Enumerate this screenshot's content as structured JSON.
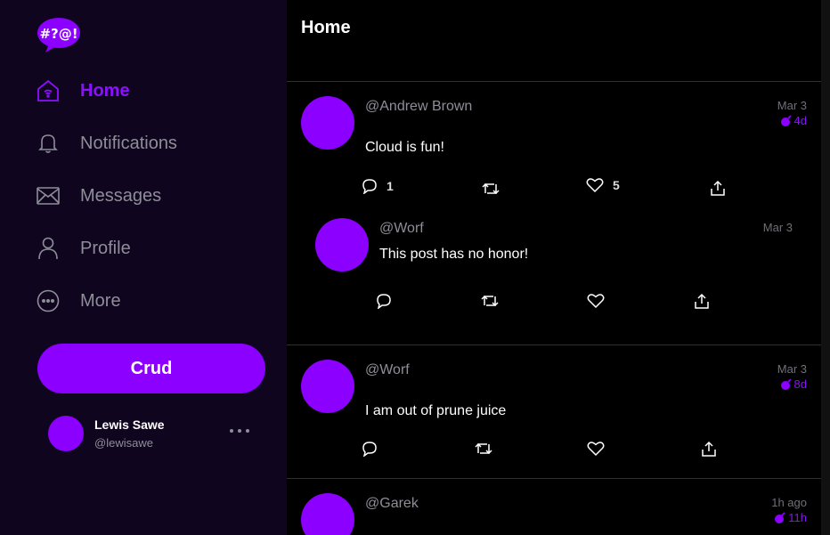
{
  "app": {
    "logo_text": "#?@!"
  },
  "sidebar": {
    "items": [
      {
        "label": "Home",
        "icon": "home-icon",
        "active": true
      },
      {
        "label": "Notifications",
        "icon": "bell-icon"
      },
      {
        "label": "Messages",
        "icon": "mail-icon"
      },
      {
        "label": "Profile",
        "icon": "user-icon"
      },
      {
        "label": "More",
        "icon": "more-circle-icon"
      }
    ],
    "crud_label": "Crud",
    "user": {
      "name": "Lewis Sawe",
      "handle": "@lewisawe"
    }
  },
  "colors": {
    "accent": "#8c00ff",
    "sidebar_bg": "#0f051e",
    "text_muted": "#8e8e98"
  },
  "main": {
    "title": "Home",
    "posts": [
      {
        "handle": "@Andrew Brown",
        "date": "Mar 3",
        "ttl": "4d",
        "text": "Cloud is fun!",
        "reply_count": "1",
        "like_count": "5",
        "reply": {
          "handle": "@Worf",
          "date": "Mar 3",
          "text": "This post has no honor!"
        }
      },
      {
        "handle": "@Worf",
        "date": "Mar 3",
        "ttl": "8d",
        "text": "I am out of prune juice"
      },
      {
        "handle": "@Garek",
        "date": "1h ago",
        "ttl": "11h"
      }
    ]
  }
}
